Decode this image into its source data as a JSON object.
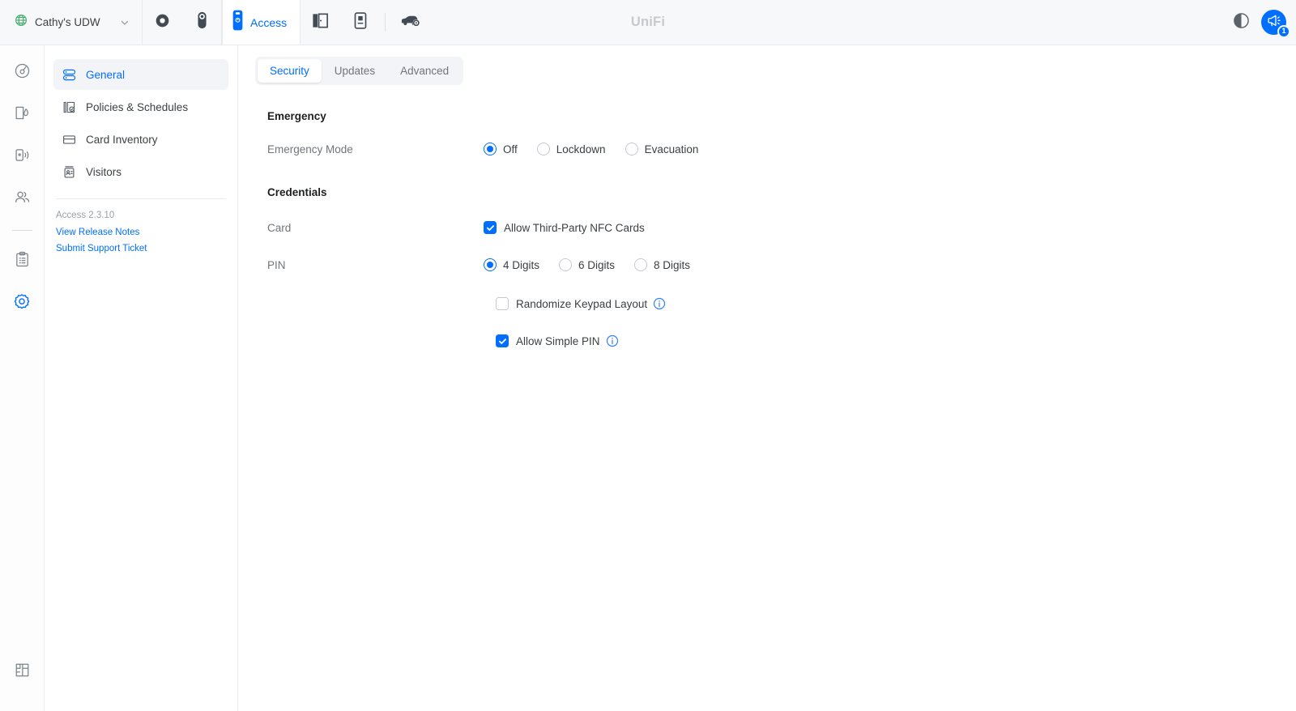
{
  "colors": {
    "accent": "#006fff",
    "topbar_bg": "#f7f8f9",
    "active_nav_bg": "#f2f4f7",
    "muted_text": "#70757a",
    "wordmark": "#c6c9ce",
    "globe_green": "#4caf72"
  },
  "topbar": {
    "org_name": "Cathy's UDW",
    "globe_icon": "globe-icon",
    "chevron_icon": "chevron-down-icon",
    "wordmark": "UniFi",
    "apps": [
      {
        "id": "network",
        "icon": "network-ring-icon",
        "label": "",
        "active": false
      },
      {
        "id": "protect",
        "icon": "protect-camera-icon",
        "label": "",
        "active": false
      },
      {
        "id": "access",
        "icon": "access-door-reader-icon",
        "label": "Access",
        "active": true
      },
      {
        "id": "talk",
        "icon": "talk-door-icon",
        "label": "",
        "active": false
      },
      {
        "id": "intercom",
        "icon": "intercom-panel-icon",
        "label": "",
        "active": false
      },
      {
        "id": "drive",
        "icon": "connect-vehicle-gear-icon",
        "label": "",
        "active": false
      }
    ],
    "theme_toggle_icon": "contrast-theme-icon",
    "announcements_icon": "megaphone-icon",
    "announcements_count": "1"
  },
  "rail": {
    "items": [
      {
        "id": "dashboard",
        "icon": "dashboard-gauge-icon",
        "active": false
      },
      {
        "id": "doors",
        "icon": "door-lock-icon",
        "active": false
      },
      {
        "id": "devices",
        "icon": "device-reader-signal-icon",
        "active": false
      },
      {
        "id": "users",
        "icon": "users-icon",
        "active": false
      },
      {
        "id": "logs",
        "icon": "clipboard-logs-icon",
        "active": false
      },
      {
        "id": "settings",
        "icon": "gear-icon",
        "active": true
      }
    ],
    "bottom_item": {
      "id": "floorplan",
      "icon": "floorplan-icon",
      "active": false
    }
  },
  "sidebar": {
    "items": [
      {
        "id": "general",
        "label": "General",
        "icon": "server-stack-icon",
        "active": true
      },
      {
        "id": "policies",
        "label": "Policies & Schedules",
        "icon": "policy-shield-icon",
        "active": false
      },
      {
        "id": "card-inventory",
        "label": "Card Inventory",
        "icon": "card-icon",
        "active": false
      },
      {
        "id": "visitors",
        "label": "Visitors",
        "icon": "visitor-badge-icon",
        "active": false
      }
    ],
    "version": "Access 2.3.10",
    "links": [
      {
        "id": "release-notes",
        "label": "View Release Notes"
      },
      {
        "id": "support-ticket",
        "label": "Submit Support Ticket"
      }
    ]
  },
  "main": {
    "tabs": [
      {
        "id": "security",
        "label": "Security",
        "active": true
      },
      {
        "id": "updates",
        "label": "Updates",
        "active": false
      },
      {
        "id": "advanced",
        "label": "Advanced",
        "active": false
      }
    ],
    "sections": {
      "emergency": {
        "title": "Emergency",
        "mode_label": "Emergency Mode",
        "mode_options": [
          {
            "id": "off",
            "label": "Off",
            "selected": true
          },
          {
            "id": "lockdown",
            "label": "Lockdown",
            "selected": false
          },
          {
            "id": "evacuation",
            "label": "Evacuation",
            "selected": false
          }
        ]
      },
      "credentials": {
        "title": "Credentials",
        "card_label": "Card",
        "card_checkbox": {
          "id": "third-party-nfc",
          "label": "Allow Third-Party NFC Cards",
          "checked": true
        },
        "pin_label": "PIN",
        "pin_options": [
          {
            "id": "pin-4",
            "label": "4 Digits",
            "selected": true
          },
          {
            "id": "pin-6",
            "label": "6 Digits",
            "selected": false
          },
          {
            "id": "pin-8",
            "label": "8 Digits",
            "selected": false
          }
        ],
        "randomize_keypad": {
          "id": "randomize-keypad",
          "label": "Randomize Keypad Layout",
          "checked": false,
          "info_icon": "info-icon"
        },
        "simple_pin": {
          "id": "simple-pin",
          "label": "Allow Simple PIN",
          "checked": true,
          "info_icon": "info-icon"
        }
      }
    }
  }
}
